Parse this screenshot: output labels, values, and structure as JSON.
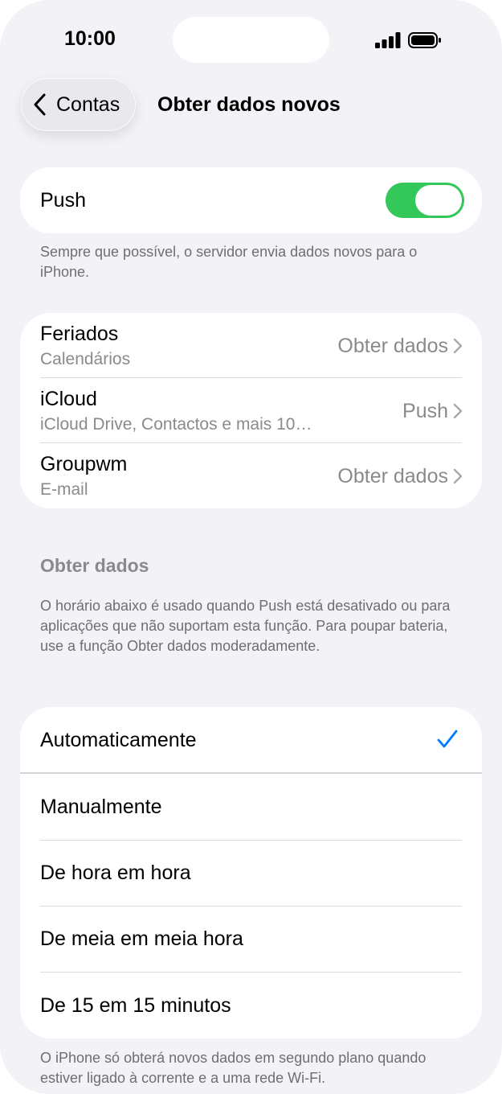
{
  "status_bar": {
    "time": "10:00",
    "signal_icon": "cellular-signal-icon",
    "battery_icon": "battery-icon"
  },
  "nav": {
    "back_label": "Contas",
    "back_icon": "chevron-left-icon",
    "title": "Obter dados novos"
  },
  "push": {
    "label": "Push",
    "enabled": true,
    "toggle_on_color": "#34c759",
    "footnote": "Sempre que possível, o servidor envia dados novos para o iPhone."
  },
  "accounts": [
    {
      "title": "Feriados",
      "subtitle": "Calendários",
      "value": "Obter dados"
    },
    {
      "title": "iCloud",
      "subtitle": "iCloud Drive, Contactos e mais 10…",
      "value": "Push"
    },
    {
      "title": "Groupwm",
      "subtitle": "E-mail",
      "value": "Obter dados"
    }
  ],
  "fetch_section": {
    "header": "Obter dados",
    "description": "O horário abaixo é usado quando Push está desativado ou para aplicações que não suportam esta função. Para poupar bateria, use a função Obter dados moderadamente.",
    "options": [
      {
        "label": "Automaticamente",
        "selected": true
      },
      {
        "label": "Manualmente",
        "selected": false
      },
      {
        "label": "De hora em hora",
        "selected": false
      },
      {
        "label": "De meia em meia hora",
        "selected": false
      },
      {
        "label": "De 15 em 15 minutos",
        "selected": false
      }
    ],
    "check_color": "#007aff",
    "footnote": "O iPhone só obterá novos dados em segundo plano quando estiver ligado à corrente e a uma rede Wi-Fi."
  }
}
